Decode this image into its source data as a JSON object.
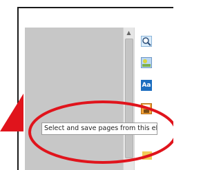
{
  "tooltip": {
    "text": "Select and save pages from this eBook"
  },
  "scrollbar": {
    "up_arrow": "▲"
  },
  "toolbar": {
    "icons": [
      "magnifier-icon",
      "image-icon",
      "text-aa-icon",
      "save-disk-icon",
      "partial-folder-icon"
    ],
    "text_icon_label": "Aa"
  },
  "annotation": {
    "highlight_color": "#e0141c"
  }
}
